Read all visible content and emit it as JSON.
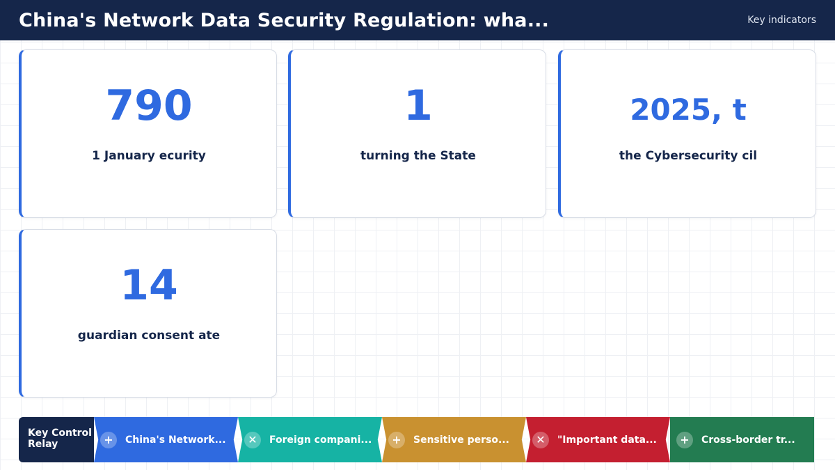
{
  "header": {
    "title": "China's Network Data Security Regulation: wha...",
    "tag": "Key indicators"
  },
  "cards": [
    {
      "value": "790",
      "label": "1 January ecurity"
    },
    {
      "value": "1",
      "label": "turning the State"
    },
    {
      "value": "2025, t",
      "label": "the Cybersecurity cil"
    },
    {
      "value": "14",
      "label": "guardian consent ate"
    }
  ],
  "relay": {
    "title_line1": "Key Control",
    "title_line2": "Relay",
    "steps": [
      {
        "icon": "plus-icon",
        "glyph": "+",
        "label": "China's Network...",
        "color": "#2f6ae0"
      },
      {
        "icon": "close-icon",
        "glyph": "✕",
        "label": "Foreign compani...",
        "color": "#16b3a4"
      },
      {
        "icon": "plus-icon",
        "glyph": "+",
        "label": "Sensitive perso...",
        "color": "#c99130"
      },
      {
        "icon": "close-icon",
        "glyph": "✕",
        "label": "\"Important data...",
        "color": "#c41f30"
      },
      {
        "icon": "plus-icon",
        "glyph": "+",
        "label": "Cross-border tr...",
        "color": "#237c51"
      }
    ]
  },
  "colors": {
    "header_bg": "#15264a",
    "accent": "#2f6ae0"
  }
}
